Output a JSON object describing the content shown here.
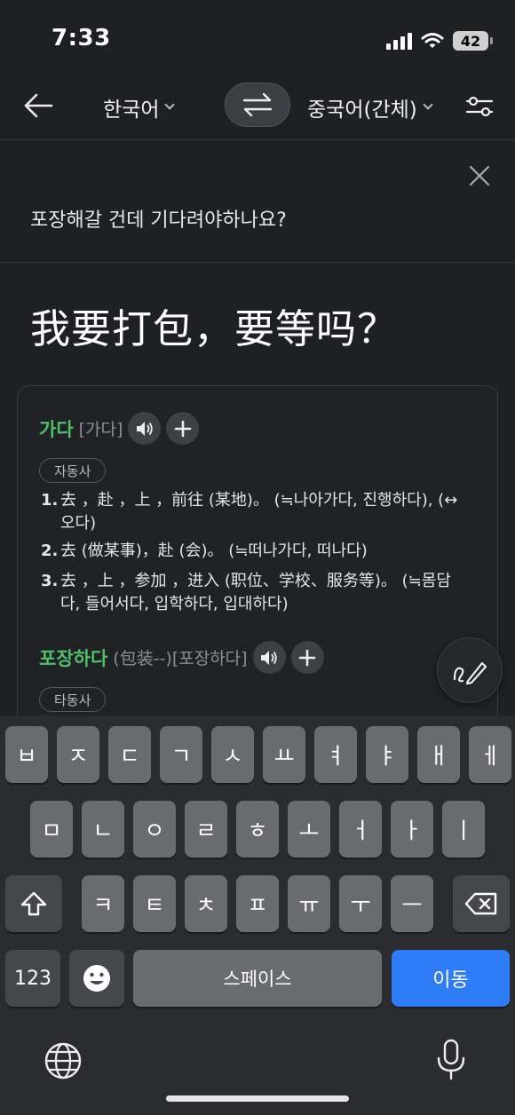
{
  "status_bar": {
    "time": "7:33",
    "battery": "42"
  },
  "header": {
    "source_lang": "한국어",
    "target_lang": "중국어(간체)"
  },
  "source": {
    "text": "포장해갈 건데 기다려야하나요?"
  },
  "translation": {
    "text": "我要打包，要等吗？"
  },
  "dictionary": {
    "entries": [
      {
        "word": "가다",
        "pron": "[가다]",
        "pos": "자동사",
        "definitions": [
          {
            "num": "1.",
            "text": "去 ，赴 ，上 ，前往 (某地)。 (≒나아가다, 진행하다), (↔오다)"
          },
          {
            "num": "2.",
            "text": "去 (做某事)，赴 (会)。 (≒떠나가다, 떠나다)"
          },
          {
            "num": "3.",
            "text": "去 ，上 ，参加 ，进入 (职位、学校、服务等)。 (≒몸담다, 들어서다, 입학하다, 입대하다)"
          }
        ]
      },
      {
        "word": "포장하다",
        "pron": "(包装--)[포장하다]",
        "pos": "타동사"
      }
    ]
  },
  "keyboard": {
    "row1": [
      "ㅂ",
      "ㅈ",
      "ㄷ",
      "ㄱ",
      "ㅅ",
      "ㅛ",
      "ㅕ",
      "ㅑ",
      "ㅐ",
      "ㅔ"
    ],
    "row2": [
      "ㅁ",
      "ㄴ",
      "ㅇ",
      "ㄹ",
      "ㅎ",
      "ㅗ",
      "ㅓ",
      "ㅏ",
      "ㅣ"
    ],
    "row3": [
      "ㅋ",
      "ㅌ",
      "ㅊ",
      "ㅍ",
      "ㅠ",
      "ㅜ",
      "ㅡ"
    ],
    "numbers_label": "123",
    "space_label": "스페이스",
    "go_label": "이동"
  }
}
